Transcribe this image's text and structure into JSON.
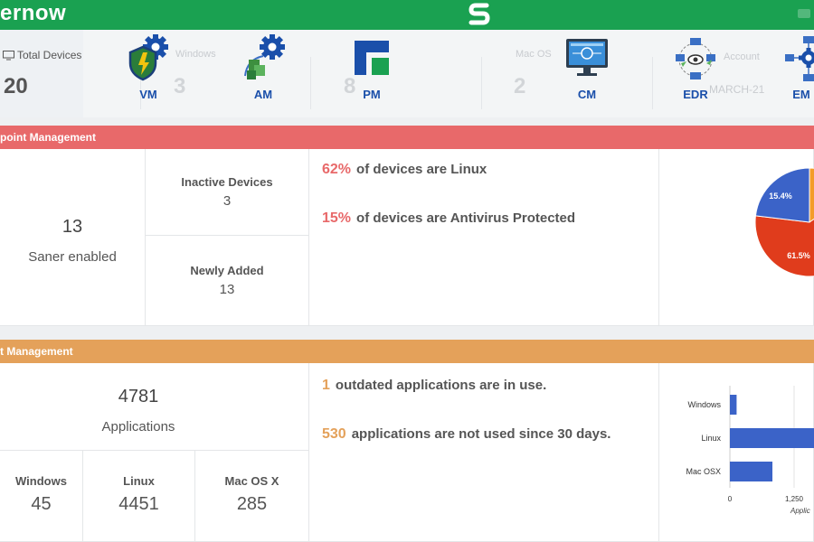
{
  "app": {
    "brand": "ernow"
  },
  "summary": {
    "total_label": "Total Devices",
    "total_value": "20",
    "faded_windows_label": "Windows",
    "faded_windows_value": "3",
    "faded_linux_value": "8",
    "faded_mac_label": "Mac OS",
    "faded_mac_value": "2",
    "faded_account_label": "Account",
    "faded_date": "MARCH-21"
  },
  "modules": [
    {
      "label": "VM",
      "icon": "vulnerability-shield-gear-icon"
    },
    {
      "label": "AM",
      "icon": "asset-cubes-gear-icon"
    },
    {
      "label": "PM",
      "icon": "patch-blocks-icon"
    },
    {
      "label": "CM",
      "icon": "compliance-monitor-icon"
    },
    {
      "label": "EDR",
      "icon": "edr-network-eye-icon"
    },
    {
      "label": "EM",
      "icon": "endpoint-network-gear-icon"
    }
  ],
  "endpoint": {
    "header": "point Management",
    "enabled_value": "13",
    "enabled_label": "Saner enabled",
    "inactive_title": "Inactive Devices",
    "inactive_value": "3",
    "newly_title": "Newly Added",
    "newly_value": "13",
    "stat1_pct": "62%",
    "stat1_text": "of devices are Linux",
    "stat2_pct": "15%",
    "stat2_text": "of devices are Antivirus Protected",
    "pie_label_1": "15.4%",
    "pie_label_2": "61.5%"
  },
  "asset": {
    "header": "t Management",
    "apps_value": "4781",
    "apps_label": "Applications",
    "windows_title": "Windows",
    "windows_value": "45",
    "linux_title": "Linux",
    "linux_value": "4451",
    "mac_title": "Mac OS X",
    "mac_value": "285",
    "stat1_num": "1",
    "stat1_text": "outdated applications are in use.",
    "stat2_num": "530",
    "stat2_text": "applications are not used since 30 days.",
    "axis_tick_0": "0",
    "axis_tick_1": "1,250",
    "axis_caption": "Applic"
  },
  "chart_data": [
    {
      "type": "pie",
      "labels": [
        "15.4%",
        "61.5%"
      ],
      "values": [
        15.4,
        61.5,
        23.1
      ],
      "colors": [
        "#f39c2a",
        "#e03c1c",
        "#3b63c8"
      ]
    },
    {
      "type": "bar",
      "orientation": "horizontal",
      "categories": [
        "Windows",
        "Linux",
        "Mac OSX"
      ],
      "values": [
        45,
        4451,
        285
      ],
      "x_ticks": [
        "0",
        "1,250"
      ],
      "color": "#3b63c8"
    }
  ],
  "colors": {
    "brand_green": "#1aa151",
    "endpoint_red": "#e8696a",
    "asset_orange": "#e4a15a",
    "module_blue": "#1a4faa",
    "bar_blue": "#3b63c8"
  }
}
